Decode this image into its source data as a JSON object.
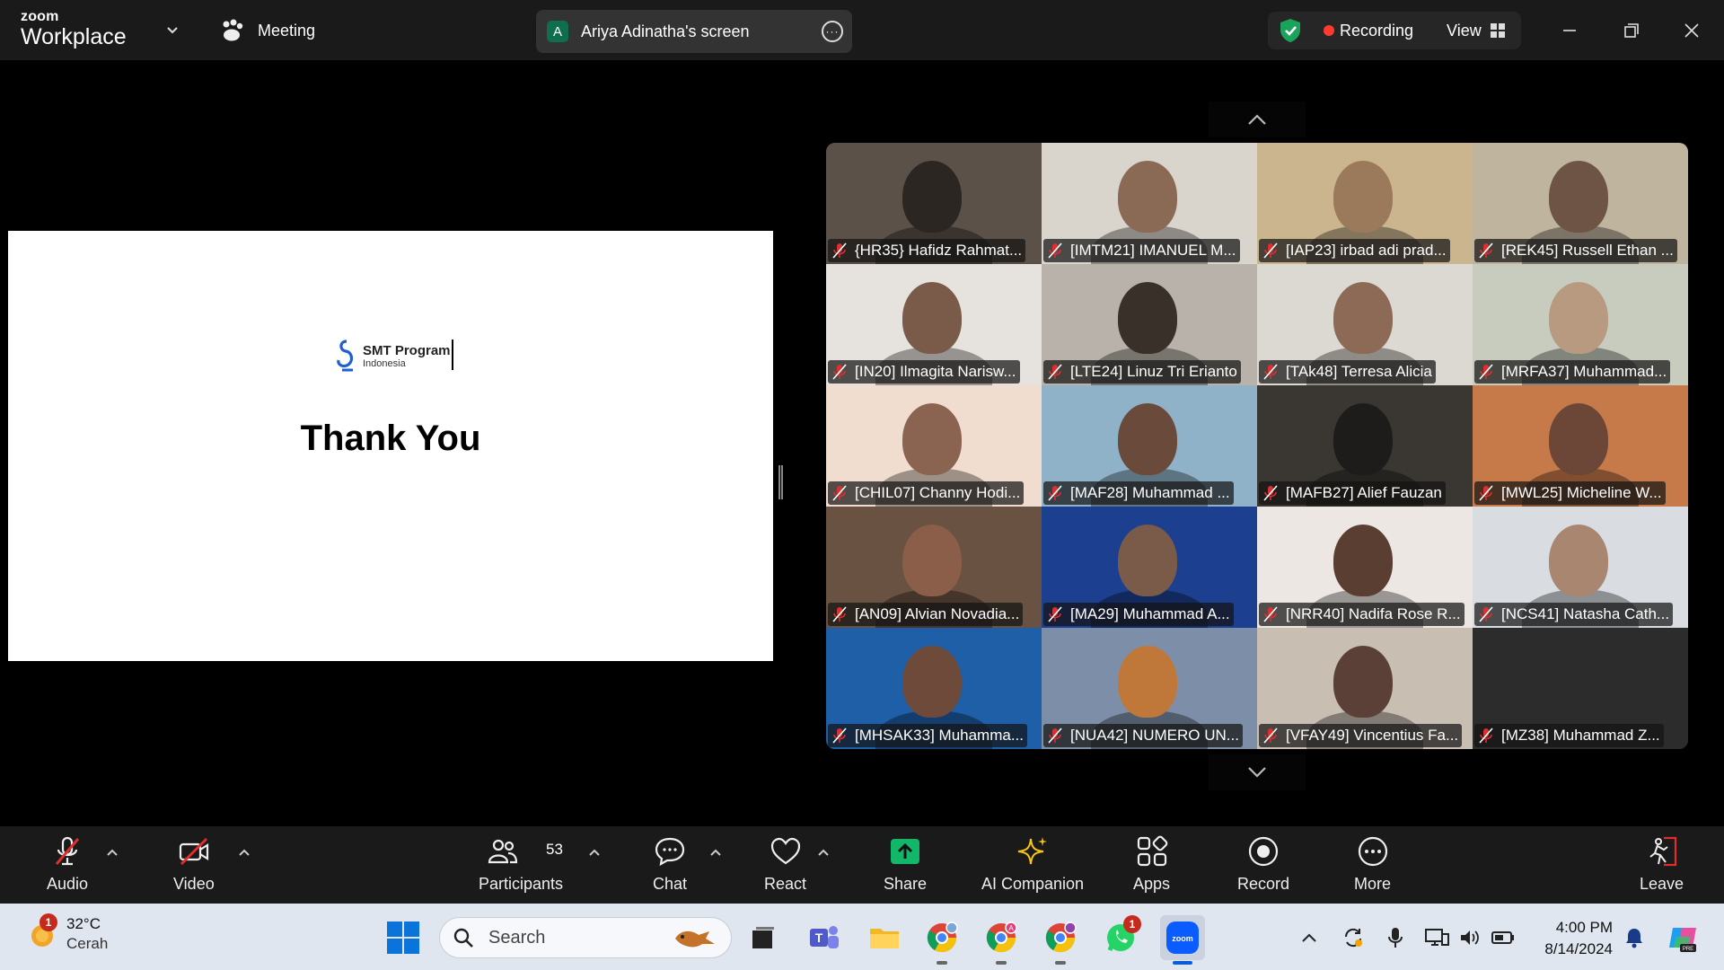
{
  "app": {
    "brand_small": "zoom",
    "brand_big": "Workplace",
    "meeting_label": "Meeting"
  },
  "share": {
    "avatar_letter": "A",
    "label": "Ariya Adinatha's screen"
  },
  "status": {
    "recording_label": "Recording",
    "view_label": "View"
  },
  "slide": {
    "logo_title": "SMT Program",
    "logo_subtitle": "Indonesia",
    "heading": "Thank You"
  },
  "participants": [
    {
      "name": "{HR35} Hafidz Rahmat...",
      "bg": "#5b5148",
      "skin": "#2b2622"
    },
    {
      "name": "[IMTM21] IMANUEL M...",
      "bg": "#d9d4cc",
      "skin": "#8a6a55"
    },
    {
      "name": "[IAP23]  irbad adi prad...",
      "bg": "#cbb58f",
      "skin": "#9a7a5a"
    },
    {
      "name": "[REK45] Russell Ethan ...",
      "bg": "#bfb49e",
      "skin": "#6e5444"
    },
    {
      "name": "[IN20] Ilmagita Narisw...",
      "bg": "#e6e2dd",
      "skin": "#7a5a48"
    },
    {
      "name": "[LTE24] Linuz Tri Erianto",
      "bg": "#b8b2aa",
      "skin": "#3a302a"
    },
    {
      "name": "[TAk48] Terresa Alicia",
      "bg": "#dcd8d2",
      "skin": "#8c6a55"
    },
    {
      "name": "[MRFA37] Muhammad...",
      "bg": "#c8ccbf",
      "skin": "#b89a80"
    },
    {
      "name": "[CHIL07] Channy Hodi...",
      "bg": "#f1ddd0",
      "skin": "#8a6450"
    },
    {
      "name": "[MAF28] Muhammad ...",
      "bg": "#8fb2c8",
      "skin": "#6a4a3a"
    },
    {
      "name": "[MAFB27] Alief Fauzan",
      "bg": "#3a3631",
      "skin": "#1e1c1a"
    },
    {
      "name": "[MWL25] Micheline W...",
      "bg": "#c67a4a",
      "skin": "#6c4636"
    },
    {
      "name": "[AN09] Alvian Novadia...",
      "bg": "#6a5242",
      "skin": "#8a5e48"
    },
    {
      "name": "[MA29]  Muhammad A...",
      "bg": "#1d3f8f",
      "skin": "#7a5a48"
    },
    {
      "name": "[NRR40] Nadifa Rose R...",
      "bg": "#ece7e2",
      "skin": "#5a3e32"
    },
    {
      "name": "[NCS41] Natasha Cath...",
      "bg": "#d9dde2",
      "skin": "#a88670"
    },
    {
      "name": "[MHSAK33] Muhamma...",
      "bg": "#1f5fa8",
      "skin": "#6e4a3a"
    },
    {
      "name": "[NUA42] NUMERO UN...",
      "bg": "#7d8fa8",
      "skin": "#c0783a"
    },
    {
      "name": "[VFAY49] Vincentius Fa...",
      "bg": "#c8beb2",
      "skin": "#5a4036"
    },
    {
      "name": "[MZ38] Muhammad Z...",
      "bg": "#2c2c2c",
      "skin": ""
    }
  ],
  "toolbar": {
    "audio": "Audio",
    "video": "Video",
    "participants": "Participants",
    "participant_count": "53",
    "chat": "Chat",
    "react": "React",
    "share": "Share",
    "ai": "AI Companion",
    "apps": "Apps",
    "record": "Record",
    "more": "More",
    "leave": "Leave"
  },
  "taskbar": {
    "weather_temp": "32°C",
    "weather_cond": "Cerah",
    "weather_badge": "1",
    "search_placeholder": "Search",
    "whatsapp_badge": "1",
    "time": "4:00 PM",
    "date": "8/14/2024"
  },
  "colors": {
    "share_green": "#12b76a",
    "record_red": "#ff3b30",
    "muted_red": "#e02e2e"
  }
}
